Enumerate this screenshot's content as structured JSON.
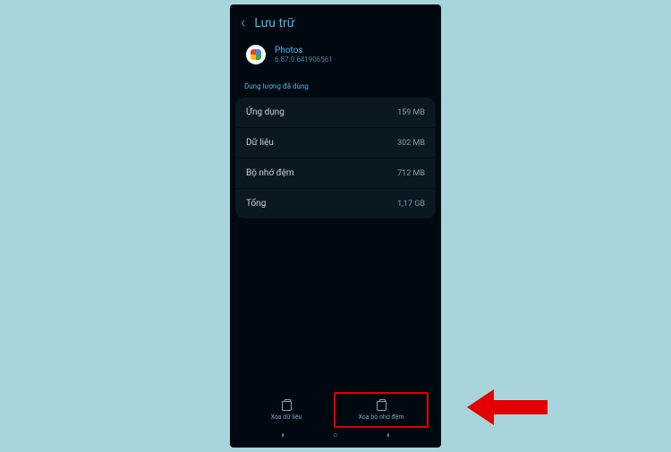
{
  "header": {
    "title": "Lưu trữ"
  },
  "app": {
    "name": "Photos",
    "version": "6.87.0.641906561"
  },
  "section_title": "Dung lượng đã dùng",
  "storage": [
    {
      "label": "Ứng dụng",
      "value": "159 MB"
    },
    {
      "label": "Dữ liệu",
      "value": "302 MB"
    },
    {
      "label": "Bộ nhớ đệm",
      "value": "712 MB"
    },
    {
      "label": "Tổng",
      "value": "1,17 GB"
    }
  ],
  "actions": {
    "clear_data": "Xóa dữ liệu",
    "clear_cache": "Xóa bộ nhớ đệm"
  }
}
